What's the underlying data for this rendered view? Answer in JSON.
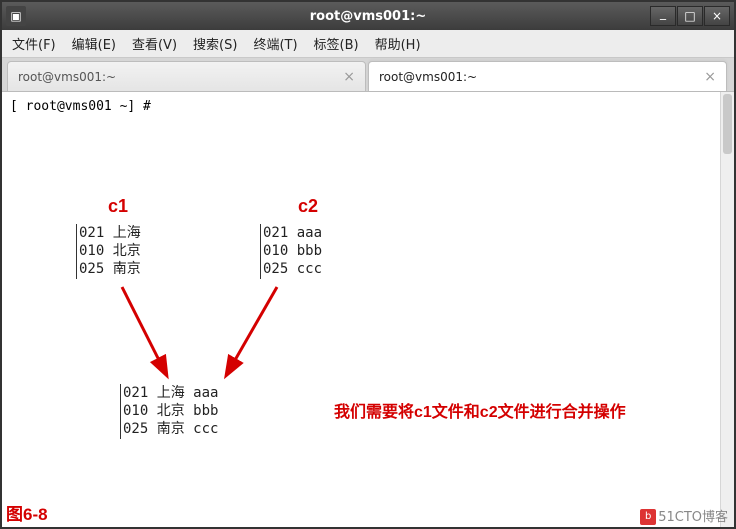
{
  "window": {
    "title": "root@vms001:~"
  },
  "menu": {
    "file": "文件(F)",
    "edit": "编辑(E)",
    "view": "查看(V)",
    "search": "搜索(S)",
    "terminal": "终端(T)",
    "tabs": "标签(B)",
    "help": "帮助(H)"
  },
  "tabs": [
    {
      "label": "root@vms001:~",
      "active": false
    },
    {
      "label": "root@vms001:~",
      "active": true
    }
  ],
  "prompt": "[ root@vms001 ~] # ",
  "annotations": {
    "c1_label": "c1",
    "c2_label": "c2",
    "c1_block": "021 上海\n010 北京\n025 南京",
    "c2_block": "021 aaa\n010 bbb\n025 ccc",
    "merged_block": "021 上海 aaa\n010 北京 bbb\n025 南京 ccc",
    "description": "我们需要将c1文件和c2文件进行合并操作",
    "figure_label": "图6-8"
  },
  "footer": {
    "watermark": "51CTO博客"
  }
}
